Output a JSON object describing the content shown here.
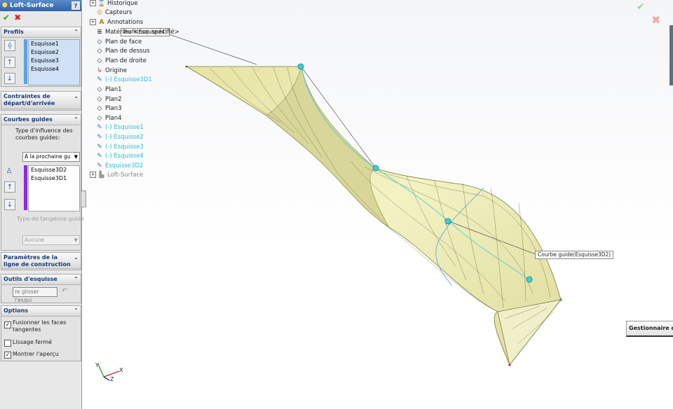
{
  "property_manager": {
    "title": "Loft-Surface",
    "help": "?",
    "ok_glyph": "✔",
    "cancel_glyph": "✖",
    "profils": {
      "header": "Profils",
      "items": [
        "Esquisse1",
        "Esquisse2",
        "Esquisse3",
        "Esquisse4"
      ]
    },
    "contraintes": {
      "header": "Contraintes de départ/d'arrivée"
    },
    "courbes_guides": {
      "header": "Courbes guides",
      "influence_label": "Type d'influence des courbes guides:",
      "influence_value": "A la prochaine gu",
      "items": [
        "Esquisse3D2",
        "Esquisse3D1"
      ],
      "tangence_label": "Type de tangence guide",
      "tangence_value": "Aucune"
    },
    "parametres": {
      "header": "Paramètres de la ligne de construction"
    },
    "outils": {
      "header": "Outils d'esquisse",
      "drag_placeholder": "re glisser l'esqui"
    },
    "options": {
      "header": "Options",
      "fusion_label": "Fusionner les faces tangentes",
      "fusion_checked": "✓",
      "lissage_label": "Lissage fermé",
      "apercu_label": "Montrer l'aperçu",
      "apercu_checked": "✓"
    }
  },
  "tree": {
    "items": [
      {
        "label": "Historique"
      },
      {
        "label": "Capteurs"
      },
      {
        "label": "Annotations"
      },
      {
        "label": "Matériau <non spécifié>"
      },
      {
        "label": "Plan de face"
      },
      {
        "label": "Plan de dessus"
      },
      {
        "label": "Plan de droite"
      },
      {
        "label": "Origine"
      },
      {
        "label": "(-) Esquisse3D1"
      },
      {
        "label": "Plan1"
      },
      {
        "label": "Plan2"
      },
      {
        "label": "Plan3"
      },
      {
        "label": "Plan4"
      },
      {
        "label": "(-) Esquisse1"
      },
      {
        "label": "(-) Esquisse2"
      },
      {
        "label": "(-) Esquisse3"
      },
      {
        "label": "(-) Esquisse4"
      },
      {
        "label": "Esquisse3D2"
      },
      {
        "label": "Loft-Surface"
      }
    ]
  },
  "viewport": {
    "callout_profil": "Profil(Esquisse4)",
    "callout_guide": "Courbe guide(Esquisse3D2)",
    "gestionnaire": "Gestionnaire de",
    "triad_x": "X",
    "triad_y": "Y",
    "triad_z": "Z"
  },
  "colors": {
    "surface": "#ecebb4",
    "surface_edge": "#7a7a3a",
    "guide": "#3cc7d8",
    "profile_bar": "#5aa3e8",
    "guide_bar": "#8a2be2"
  }
}
